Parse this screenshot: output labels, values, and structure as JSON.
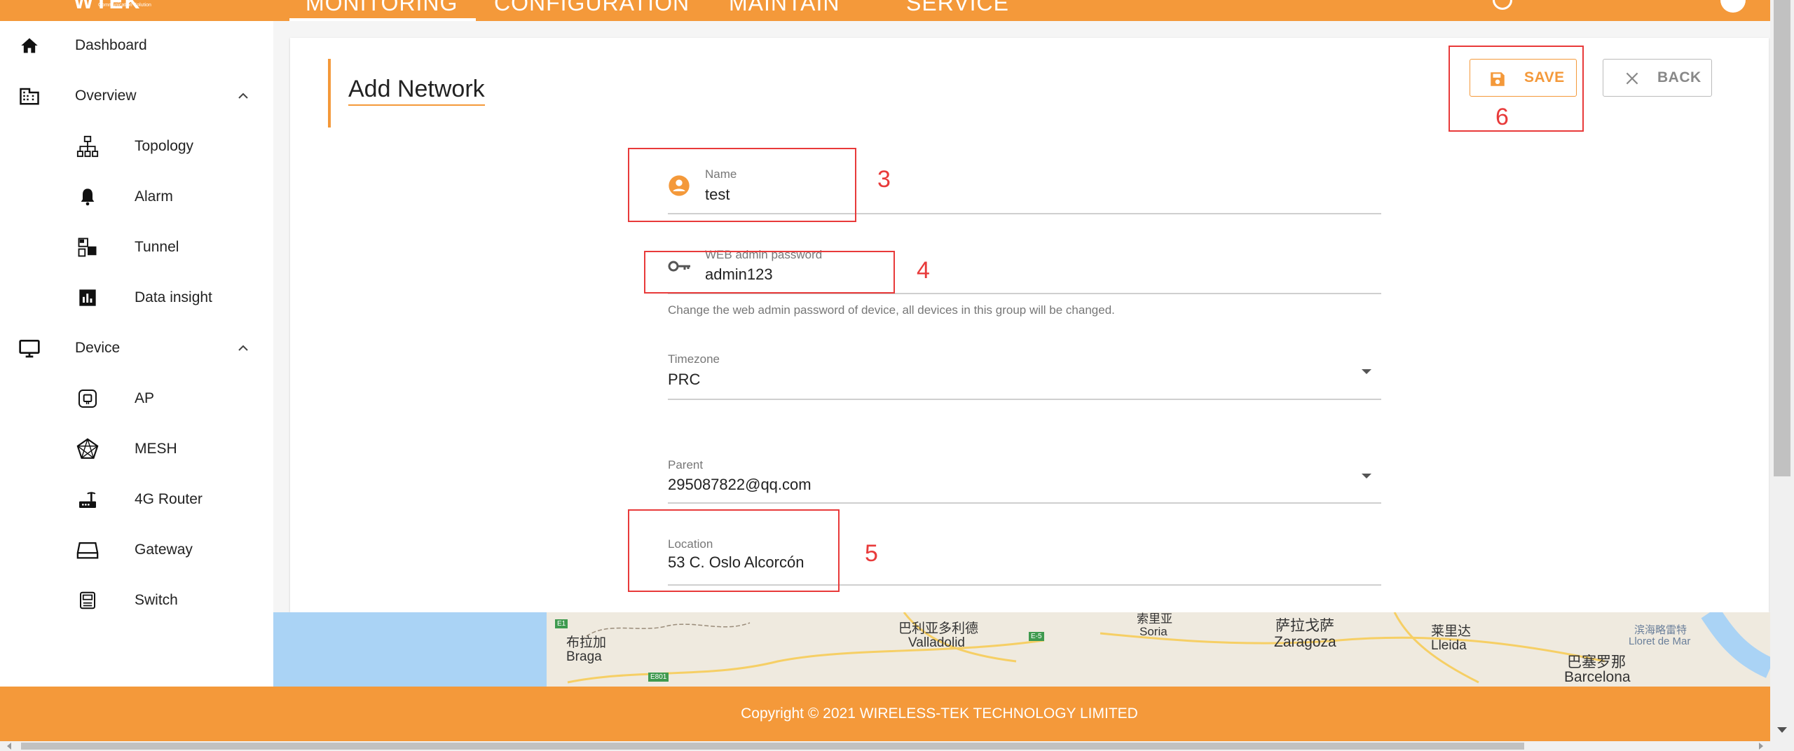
{
  "header": {
    "logo": "WTEK",
    "logo_sub": "Communication Solution",
    "nav": [
      "MONITORING",
      "CONFIGURATION",
      "MAINTAIN",
      "SERVICE"
    ],
    "active_nav": "MONITORING"
  },
  "sidebar": {
    "items": [
      {
        "label": "Dashboard",
        "icon": "home-icon"
      },
      {
        "label": "Overview",
        "icon": "building-icon",
        "expanded": true
      },
      {
        "label": "Topology",
        "icon": "topology-icon"
      },
      {
        "label": "Alarm",
        "icon": "bell-icon"
      },
      {
        "label": "Tunnel",
        "icon": "tunnel-icon"
      },
      {
        "label": "Data insight",
        "icon": "chart-icon"
      },
      {
        "label": "Device",
        "icon": "monitor-icon",
        "expanded": true
      },
      {
        "label": "AP",
        "icon": "ap-icon"
      },
      {
        "label": "MESH",
        "icon": "mesh-icon"
      },
      {
        "label": "4G Router",
        "icon": "router-icon"
      },
      {
        "label": "Gateway",
        "icon": "gateway-icon"
      },
      {
        "label": "Switch",
        "icon": "switch-icon"
      }
    ]
  },
  "page": {
    "title": "Add Network",
    "save_label": "SAVE",
    "back_label": "BACK"
  },
  "form": {
    "name": {
      "label": "Name",
      "value": "test"
    },
    "password": {
      "label": "WEB admin password",
      "value": "admin123",
      "help": "Change the web admin password of device, all devices in this group will be changed."
    },
    "timezone": {
      "label": "Timezone",
      "value": "PRC"
    },
    "parent": {
      "label": "Parent",
      "value": "295087822@qq.com"
    },
    "location": {
      "label": "Location",
      "value": "53 C. Oslo Alcorcón"
    }
  },
  "annotations": [
    "3",
    "4",
    "5",
    "6"
  ],
  "map": {
    "labels": [
      {
        "zh": "布拉加",
        "en": "Braga"
      },
      {
        "zh": "巴利亚多利德",
        "en": "Valladolid"
      },
      {
        "zh": "索里亚",
        "en": "Soria"
      },
      {
        "zh": "萨拉戈萨",
        "en": "Zaragoza"
      },
      {
        "zh": "莱里达",
        "en": "Lleida"
      },
      {
        "zh": "巴塞罗那",
        "en": "Barcelona"
      },
      {
        "zh": "滨海略雷特",
        "en": "Lloret de Mar"
      }
    ],
    "badges": [
      "E1",
      "E-5",
      "E801"
    ]
  },
  "footer": {
    "copyright": "Copyright © 2021 WIRELESS-TEK TECHNOLOGY LIMITED"
  },
  "colors": {
    "brand": "#f4993a",
    "annotation": "#e83a3a"
  }
}
